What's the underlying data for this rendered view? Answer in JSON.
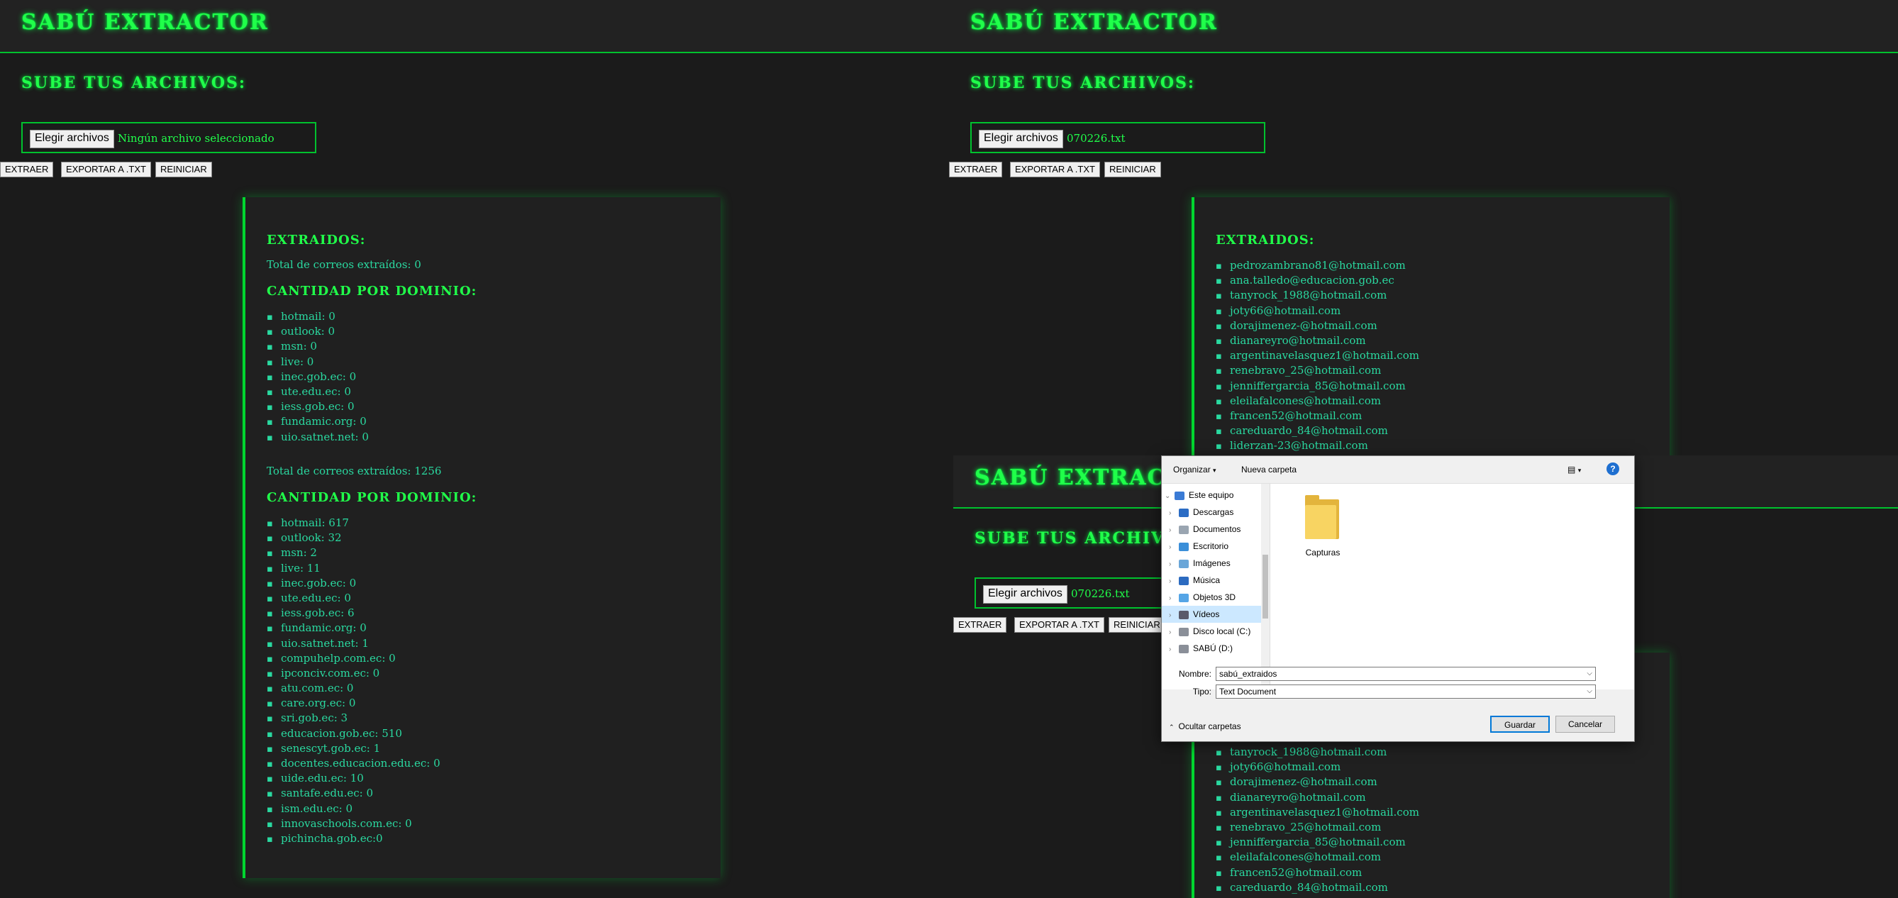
{
  "app": {
    "title": "SABÚ EXTRACTOR",
    "upload_label": "SUBE TUS ARCHIVOS:",
    "file_button": "Elegir archivos",
    "buttons": {
      "extract": "EXTRAER",
      "export": "EXPORTAR A .TXT",
      "reset": "REINICIAR"
    },
    "extracted_heading": "EXTRAIDOS:",
    "domain_heading": "CANTIDAD POR DOMINIO:"
  },
  "left": {
    "file_status": "Ningún archivo seleccionado",
    "total_zero": "Total de correos extraídos: 0",
    "domains_zero": [
      "hotmail: 0",
      "outlook: 0",
      "msn: 0",
      "live: 0",
      "inec.gob.ec: 0",
      "ute.edu.ec: 0",
      "iess.gob.ec: 0",
      "fundamic.org: 0",
      "uio.satnet.net: 0"
    ],
    "total_full": "Total de correos extraídos: 1256",
    "domains_full": [
      "hotmail: 617",
      "outlook: 32",
      "msn: 2",
      "live: 11",
      "inec.gob.ec: 0",
      "ute.edu.ec: 0",
      "iess.gob.ec: 6",
      "fundamic.org: 0",
      "uio.satnet.net: 1",
      "compuhelp.com.ec: 0",
      "ipconciv.com.ec: 0",
      "atu.com.ec: 0",
      "care.org.ec: 0",
      "sri.gob.ec: 3",
      "educacion.gob.ec: 510",
      "senescyt.gob.ec: 1",
      "docentes.educacion.edu.ec: 0",
      "uide.edu.ec: 10",
      "santafe.edu.ec: 0",
      "ism.edu.ec: 0",
      "innovaschools.com.ec: 0",
      "pichincha.gob.ec:0"
    ]
  },
  "right": {
    "file_status": "070226.txt",
    "emails": [
      "pedrozambrano81@hotmail.com",
      "ana.talledo@educacion.gob.ec",
      "tanyrock_1988@hotmail.com",
      "joty66@hotmail.com",
      "dorajimenez-@hotmail.com",
      "dianareyro@hotmail.com",
      "argentinavelasquez1@hotmail.com",
      "renebravo_25@hotmail.com",
      "jenniffergarcia_85@hotmail.com",
      "eleilafalcones@hotmail.com",
      "francen52@hotmail.com",
      "careduardo_84@hotmail.com",
      "liderzan-23@hotmail.com"
    ],
    "emails_bottom": [
      "tanyrock_1988@hotmail.com",
      "joty66@hotmail.com",
      "dorajimenez-@hotmail.com",
      "dianareyro@hotmail.com",
      "argentinavelasquez1@hotmail.com",
      "renebravo_25@hotmail.com",
      "jenniffergarcia_85@hotmail.com",
      "eleilafalcones@hotmail.com",
      "francen52@hotmail.com",
      "careduardo_84@hotmail.com"
    ]
  },
  "dialog": {
    "organize": "Organizar",
    "new_folder": "Nueva carpeta",
    "nav_items": [
      {
        "label": "Este equipo",
        "icon": "computer-icon",
        "color": "#3a7bd5"
      },
      {
        "label": "Descargas",
        "icon": "download-icon",
        "color": "#2b6cc4"
      },
      {
        "label": "Documentos",
        "icon": "document-icon",
        "color": "#9aa5b1"
      },
      {
        "label": "Escritorio",
        "icon": "desktop-icon",
        "color": "#3b8fd9"
      },
      {
        "label": "Imágenes",
        "icon": "image-icon",
        "color": "#6aa6d8"
      },
      {
        "label": "Música",
        "icon": "music-icon",
        "color": "#2c6bc0"
      },
      {
        "label": "Objetos 3D",
        "icon": "cube-icon",
        "color": "#55a5e6"
      },
      {
        "label": "Vídeos",
        "icon": "video-icon",
        "color": "#5a5a6a"
      },
      {
        "label": "Disco local (C:)",
        "icon": "drive-icon",
        "color": "#8a8f98"
      },
      {
        "label": "SABÚ (D:)",
        "icon": "drive-icon",
        "color": "#8a8f98"
      }
    ],
    "folder_name": "Capturas",
    "name_label": "Nombre:",
    "name_value": "sabú_extraidos",
    "type_label": "Tipo:",
    "type_value": "Text Document",
    "hide_folders": "Ocultar carpetas",
    "save": "Guardar",
    "cancel": "Cancelar",
    "help": "?"
  }
}
